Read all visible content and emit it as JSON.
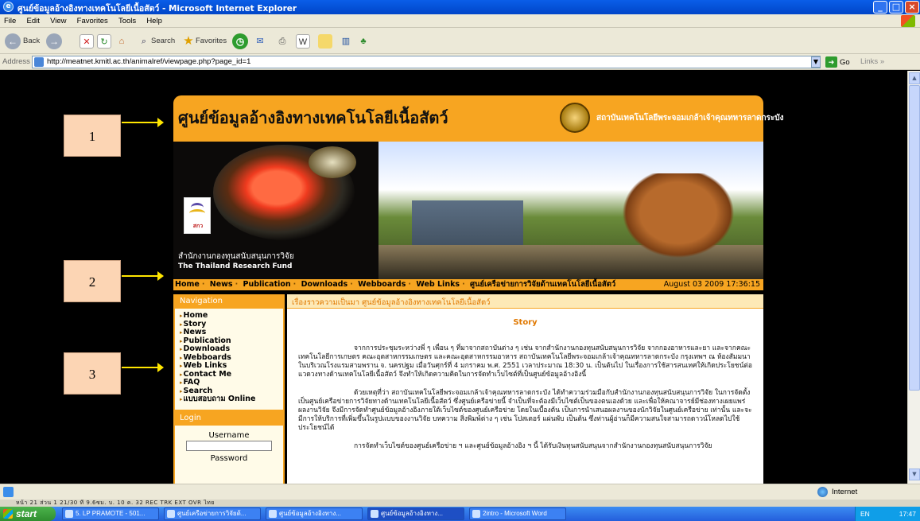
{
  "window": {
    "title": "ศูนย์ข้อมูลอ้างอิงทางเทคโนโลยีเนื้อสัตว์ - Microsoft Internet Explorer"
  },
  "menu": [
    "File",
    "Edit",
    "View",
    "Favorites",
    "Tools",
    "Help"
  ],
  "toolbar": {
    "back": "Back",
    "search": "Search",
    "favorites": "Favorites"
  },
  "address": {
    "label": "Address",
    "url": "http://meatnet.kmitl.ac.th/animalref/viewpage.php?page_id=1",
    "go": "Go",
    "links": "Links"
  },
  "site": {
    "title": "ศูนย์ข้อมูลอ้างอิงทางเทคโนโลยีเนื้อสัตว์",
    "subtitle": "สถาบันเทคโนโลยีพระจอมเกล้าเจ้าคุณทหารลาดกระบัง",
    "fund_th": "สำนักงานกองทุนสนับสนุนการวิจัย",
    "fund_en": "The Thailand Research Fund",
    "logo_text": "สกว"
  },
  "navbar": {
    "items": [
      "Home",
      "News",
      "Publication",
      "Downloads",
      "Webboards",
      "Web Links",
      "ศูนย์เครือข่ายการวิจัยด้านเทคโนโลยีเนื้อสัตว์"
    ],
    "date": "August 03 2009 17:36:15"
  },
  "navigation": {
    "heading": "Navigation",
    "items": [
      "Home",
      "Story",
      "News",
      "Publication",
      "Downloads",
      "Webboards",
      "Web Links",
      "Contact Me",
      "FAQ",
      "Search",
      "แบบสอบถาม Online"
    ]
  },
  "login": {
    "heading": "Login",
    "username_label": "Username",
    "password_label": "Password"
  },
  "main": {
    "heading": "เรื่องราวความเป็นมา ศูนย์ข้อมูลอ้างอิงทางเทคโนโลยีเนื้อสัตว์",
    "story_title": "Story",
    "paragraphs": [
      "จากการประชุมระหว่างพี่ ๆ เพื่อน ๆ ที่มาจากสถาบันต่าง ๆ เช่น จากสำนักงานกองทุนสนับสนุนการวิจัย จากกองอาหารและยา และจากคณะเทคโนโลยีการเกษตร คณะอุตสาหกรรมเกษตร และคณะอุตสาหกรรมอาหาร สถาบันเทคโนโลยีพระจอมเกล้าเจ้าคุณทหารลาดกระบัง กรุงเทพฯ ณ ห้องสัมมนา ในบริเวณโรงแรมสามพราน จ. นครปฐม เมื่อวันศุกร์ที่ 4 มกราคม พ.ศ. 2551 เวลาประมาณ 18:30 น. เป็นต้นไป ในเรื่องการใช้สารสนเทศให้เกิดประโยชน์ต่อแวดวงทางด้านเทคโนโลยีเนื้อสัตว์ จึงทำให้เกิดความคิดในการจัดทำเว็บไซต์ที่เป็นศูนย์ข้อมูลอ้างอิงนี้",
      "ด้วยเหตุที่ว่า สถาบันเทคโนโลยีพระจอมเกล้าเจ้าคุณทหารลาดกระบัง ได้ทำความร่วมมือกับสำนักงานกองทุนสนับสนุนการวิจัย ในการจัดตั้งเป็นศูนย์เครือข่ายการวิจัยทางด้านเทคโนโลยีเนื้อสัตว์ ซึ่งศูนย์เครือข่ายนี้ จำเป็นที่จะต้องมีเว็บไซต์เป็นของตนเองด้วย และเพื่อให้คณาจารย์มีช่องทางเผยแพร่ผลงานวิจัย จึงมีการจัดทำศูนย์ข้อมูลอ้างอิงภายใต้เว็บไซต์ของศูนย์เครือข่าย โดยในเบื้องต้น เป็นการนำเสนอผลงานของนักวิจัยในศูนย์เครือข่าย เท่านั้น และจะมีการให้บริการที่เพิ่มขึ้นในรูปแบบของงานวิจัย บทความ สิ่งพิมพ์ต่าง ๆ เช่น โปสเตอร์ แผ่นพับ เป็นต้น ซึ่งท่านผู้อ่านก็มีความสนใจสามารถดาวน์โหลดไปใช้ประโยชน์ได้",
      "การจัดทำเว็บไซต์ของศูนย์เครือข่าย ฯ และศูนย์ข้อมูลอ้างอิง ฯ นี้ ได้รับเงินทุนสนับสนุนจากสำนักงานกองทุนสนับสนุนการวิจัย"
    ]
  },
  "callouts": [
    "1",
    "2",
    "3"
  ],
  "status": {
    "zone": "Internet",
    "word_status": "หน้า 21    ส่วน 1    21/30    ที่    9.6ซม.    บ. 10    ค. 32    REC   TRK   EXT   OVR    ไทย"
  },
  "taskbar": {
    "start": "start",
    "tasks": [
      "5. LP PRAMOTE - 501...",
      "ศูนย์เครือข่ายการวิจัยด้...",
      "ศูนย์ข้อมูลอ้างอิงทาง...",
      "ศูนย์ข้อมูลอ้างอิงทาง...",
      "2intro - Microsoft Word"
    ],
    "lang": "EN",
    "clock": "17:47"
  },
  "colors": {
    "site_orange": "#f7a521",
    "xp_blue": "#0a5ee8",
    "callout_fill": "#fcd5b4",
    "arrow": "#ffe600"
  }
}
